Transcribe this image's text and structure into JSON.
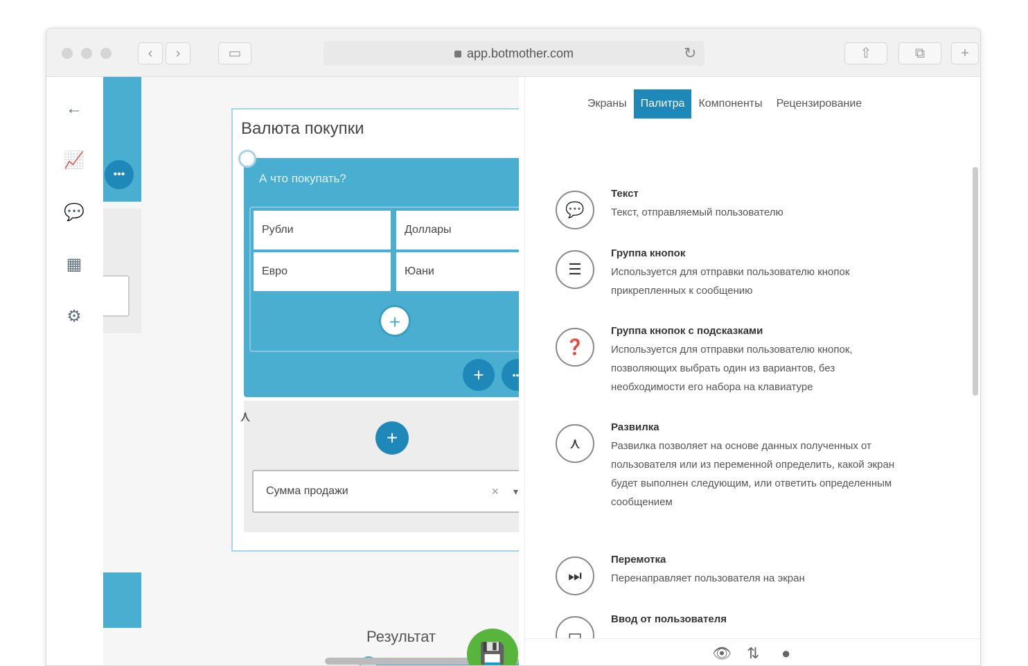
{
  "browser": {
    "url": "app.botmother.com",
    "back": "‹",
    "forward": "›",
    "reload": "↻",
    "share": "⇧",
    "tabs": "⧉",
    "new_tab": "+"
  },
  "left_tools": [
    {
      "icon": "arrow-left-icon",
      "glyph": "←"
    },
    {
      "icon": "chart-icon",
      "glyph": "📈"
    },
    {
      "icon": "chat-icon",
      "glyph": "💬"
    },
    {
      "icon": "screens-icon",
      "glyph": "▦"
    },
    {
      "icon": "settings-icon",
      "glyph": "⚙"
    }
  ],
  "editor": {
    "title": "Валюта покупки",
    "message": "А что покупать?",
    "buttons": [
      "Рубли",
      "Доллары",
      "Евро",
      "Юани"
    ],
    "select_value": "Сумма продажи",
    "select_clear": "×",
    "select_caret": "▾",
    "delete_glyph": "×",
    "add_glyph": "+",
    "more_glyph": "•••",
    "branch_glyph": "⋏",
    "forward_glyph": "➜"
  },
  "canvas": {
    "result_label": "Результат",
    "save_glyph": "💾",
    "add_glyph": "+"
  },
  "panel": {
    "tabs": [
      {
        "label": "Экраны",
        "active": false
      },
      {
        "label": "Палитра",
        "active": true
      },
      {
        "label": "Компоненты",
        "active": false
      },
      {
        "label": "Рецензирование",
        "active": false
      }
    ],
    "items": [
      {
        "icon": "text-bubble-icon",
        "glyph": "💬",
        "title": "Текст",
        "desc": "Текст, отправляемый пользователю"
      },
      {
        "icon": "button-group-icon",
        "glyph": "☰",
        "title": "Группа кнопок",
        "desc": "Используется для отправки пользователю кнопок прикрепленных к сообщению"
      },
      {
        "icon": "hint-buttons-icon",
        "glyph": "❓",
        "title": "Группа кнопок с подсказками",
        "desc": "Используется для отправки пользователю кнопок, позволяющих выбрать один из вариантов, без необходимости его набора на клавиатуре"
      },
      {
        "icon": "branch-icon",
        "glyph": "⋏",
        "title": "Развилка",
        "desc": "Развилка позволяет на основе данных полученных от пользователя или из переменной определить, какой экран будет выполнен следующим, или ответить определенным сообщением"
      },
      {
        "icon": "skip-icon",
        "glyph": "⏭",
        "title": "Перемотка",
        "desc": "Перенаправляет пользователя на экран"
      },
      {
        "icon": "user-input-icon",
        "glyph": "▭",
        "title": "Ввод от пользователя",
        "desc": ""
      }
    ],
    "bottom_icons": [
      {
        "icon": "eye-icon",
        "glyph": "👁"
      },
      {
        "icon": "sort-icon",
        "glyph": "⇅"
      },
      {
        "icon": "telegram-icon",
        "glyph": "●"
      }
    ]
  }
}
